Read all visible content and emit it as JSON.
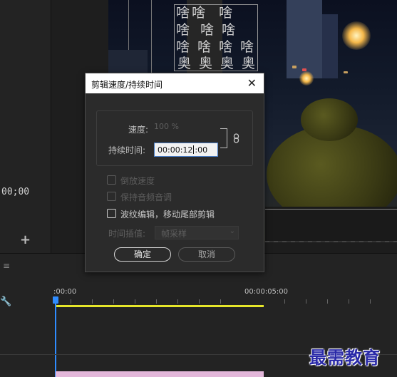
{
  "timeline_left": {
    "timecode": "00;00",
    "add_label": "+"
  },
  "logo_grid": {
    "rows": [
      [
        "啥",
        "啥",
        "啥"
      ],
      [
        "啥",
        "啥",
        "啥"
      ],
      [
        "啥",
        "啥",
        "啥",
        "啥"
      ],
      [
        "奥",
        "奥",
        "奥",
        "奥"
      ]
    ]
  },
  "timeline": {
    "menu_icon": "hamburger-icon",
    "ruler_start": ":00:00",
    "ruler_mark": "00:00:05:00"
  },
  "dialog": {
    "title": "剪辑速度/持续时间",
    "close_symbol": "✕",
    "speed_label": "速度:",
    "speed_value": "100 %",
    "duration_label": "持续时间:",
    "duration_value_before_caret": "00:00:12",
    "duration_value_after_caret": ":00",
    "link_icon": "chain-link-icon",
    "options": [
      {
        "label": "倒放速度",
        "checked": false,
        "enabled": false
      },
      {
        "label": "保持音频音调",
        "checked": false,
        "enabled": false
      },
      {
        "label": "波纹编辑，移动尾部剪辑",
        "checked": false,
        "enabled": true
      }
    ],
    "interpolation_label": "时间插值:",
    "interpolation_value": "帧采样",
    "ok_label": "确定",
    "cancel_label": "取消"
  },
  "watermark": "最需教育",
  "colors": {
    "playhead": "#2f8cff",
    "work_area": "#e6e62a",
    "clip": "#e3b7da",
    "input_focus": "#4a7ec7"
  }
}
